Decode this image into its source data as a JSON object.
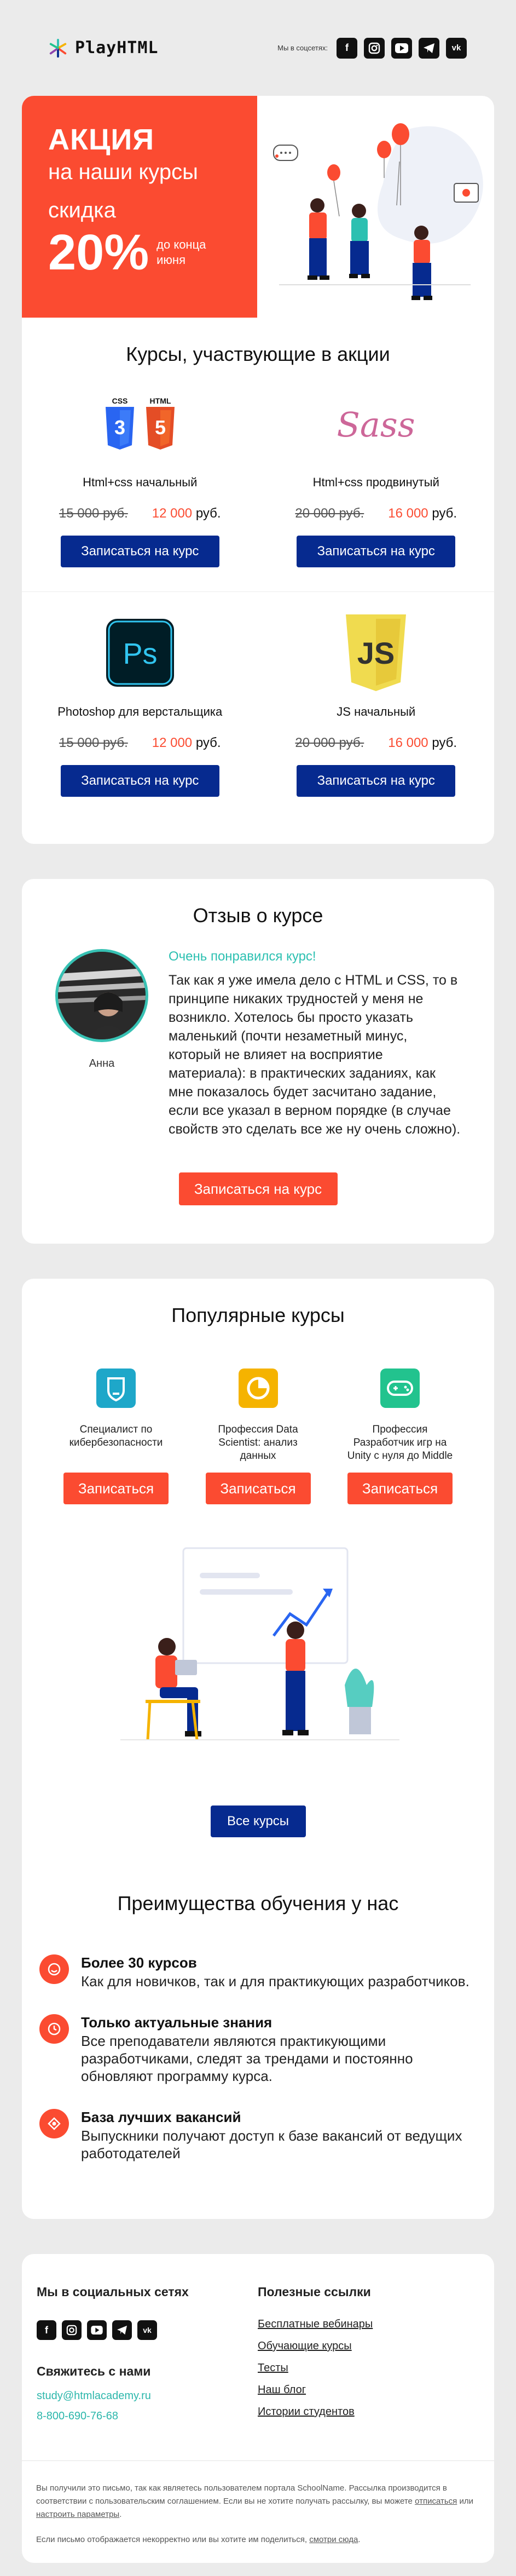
{
  "header": {
    "logo_text": "PlayHTML",
    "social_caption": "Мы в соцсетях:",
    "social_icons": [
      "facebook-icon",
      "instagram-icon",
      "youtube-icon",
      "telegram-icon",
      "vk-icon"
    ]
  },
  "hero": {
    "promo": "АКЦИЯ",
    "subtitle": "на наши курсы",
    "discount_label": "скидка",
    "discount_value": "20%",
    "until": "до конца июня"
  },
  "courses": {
    "title": "Курсы, участвующие в акции",
    "currency": "руб.",
    "button_label": "Записаться на курс",
    "items": [
      {
        "name": "Html+css начальный",
        "old_price": "15 000 руб.",
        "new_price": "12 000",
        "logo": "html-css-icon"
      },
      {
        "name": "Html+css продвинутый",
        "old_price": "20 000 руб.",
        "new_price": "16 000",
        "logo": "sass-icon"
      },
      {
        "name": "Photoshop для верстальщика",
        "old_price": "15 000 руб.",
        "new_price": "12 000",
        "logo": "photoshop-icon"
      },
      {
        "name": "JS начальный",
        "old_price": "20 000 руб.",
        "new_price": "16 000",
        "logo": "js-icon"
      }
    ]
  },
  "review": {
    "title": "Отзыв о курсе",
    "author": "Анна",
    "heading": "Очень понравился курс!",
    "text": "Так как я уже имела дело с HTML и CSS, то в принципе никаких трудностей у меня не возникло. Хотелось бы просто указать маленький (почти незаметный минус, который не влияет на восприятие материала): в практических заданиях, как мне показалось будет засчитано задание, если все указал в верном порядке (в случае свойств это сделать все же ну очень сложно).",
    "button_label": "Записаться на курс"
  },
  "popular": {
    "title": "Популярные курсы",
    "button_label": "Записаться",
    "items": [
      {
        "name": "Специалист по кибербезопасности",
        "icon": "shield-icon",
        "color": "#1ea7c9"
      },
      {
        "name": "Профессия Data Scientist: анализ данных",
        "icon": "data-icon",
        "color": "#f5b300"
      },
      {
        "name": "Профессия Разработчик игр на Unity с нуля до Middle",
        "icon": "gamepad-icon",
        "color": "#22c38e"
      }
    ],
    "all_courses_label": "Все курсы"
  },
  "advantages": {
    "title": "Преимущества обучения у нас",
    "items": [
      {
        "head": "Более 30 курсов",
        "text": "Как для новичков, так и для практикующих разработчиков.",
        "icon": "smile-icon"
      },
      {
        "head": "Только актуальные знания",
        "text": "Все преподаватели являются практикующими разработчиками, следят за трендами и постоянно обновляют программу курса.",
        "icon": "clock-icon"
      },
      {
        "head": "База лучших вакансий",
        "text": "Выпускники получают доступ к базе вакансий от ведущих работодателей",
        "icon": "target-icon"
      }
    ]
  },
  "footer": {
    "social_title": "Мы в социальных сетях",
    "contact_title": "Свяжитесь с нами",
    "email": "study@htmlacademy.ru",
    "phone": "8-800-690-76-68",
    "useful_title": "Полезные ссылки",
    "links": [
      "Бесплатные вебинары",
      "Обучающие курсы",
      "Тесты",
      "Наш блог",
      "Истории студентов"
    ],
    "legal_1": "Вы получили это письмо, так как являетесь пользователем портала SchoolName. Рассылка производится в соответствии с пользовательским соглашением. Если вы не хотите получать рассылку, вы можете",
    "unsubscribe": "отписаться",
    "legal_or": "или",
    "setup": "настроить параметры",
    "legal_2": "Если письмо отображается некорректно или вы хотите им поделиться,",
    "view_browser": "смотри сюда"
  },
  "colors": {
    "accent": "#fb4b31",
    "navy": "#062a8f",
    "teal": "#2cc0b1"
  }
}
